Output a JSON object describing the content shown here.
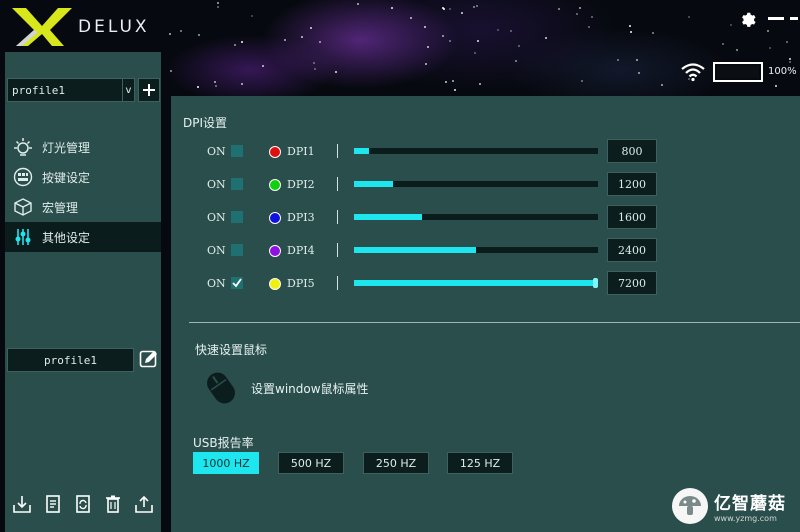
{
  "app": {
    "brand": "DELUX"
  },
  "window": {
    "settings_icon": "gear-icon",
    "minimize_icon": "minimize-icon",
    "close_icon": "close-icon"
  },
  "status": {
    "battery_percent": "100%",
    "battery_level": 1.0,
    "wifi_icon": "wifi-icon"
  },
  "sidebar": {
    "profile_selected": "profile1",
    "profile_dropdown_arrow": "v",
    "add_profile_icon": "plus-icon",
    "menu": [
      {
        "label": "灯光管理",
        "icon": "light-icon",
        "active": false
      },
      {
        "label": "按键设定",
        "icon": "keys-icon",
        "active": false
      },
      {
        "label": "宏管理",
        "icon": "macro-icon",
        "active": false
      },
      {
        "label": "其他设定",
        "icon": "sliders-icon",
        "active": true
      }
    ],
    "profile_name": "profile1",
    "edit_icon": "edit-icon",
    "tools": [
      "import-icon",
      "export-doc-icon",
      "refresh-icon",
      "delete-icon",
      "upload-icon"
    ]
  },
  "dpi": {
    "title": "DPI设置",
    "rows": [
      {
        "on_label": "ON",
        "checked": false,
        "color": "#e01010",
        "label": "DPI1",
        "value": "800",
        "fraction": 0.06
      },
      {
        "on_label": "ON",
        "checked": false,
        "color": "#10d010",
        "label": "DPI2",
        "value": "1200",
        "fraction": 0.16
      },
      {
        "on_label": "ON",
        "checked": false,
        "color": "#1010e0",
        "label": "DPI3",
        "value": "1600",
        "fraction": 0.28
      },
      {
        "on_label": "ON",
        "checked": false,
        "color": "#9010e0",
        "label": "DPI4",
        "value": "2400",
        "fraction": 0.5
      },
      {
        "on_label": "ON",
        "checked": true,
        "color": "#f0f010",
        "label": "DPI5",
        "value": "7200",
        "fraction": 1.0
      }
    ]
  },
  "quick": {
    "title": "快速设置鼠标",
    "mouse_icon": "mouse-icon",
    "mouse_properties": "设置window鼠标属性"
  },
  "usb": {
    "title": "USB报告率",
    "options": [
      "1000 HZ",
      "500 HZ",
      "250 HZ",
      "125 HZ"
    ],
    "selected": "1000 HZ"
  },
  "watermark": {
    "name": "亿智蘑菇",
    "url": "www.yzmg.com"
  },
  "colors": {
    "accent": "#1ee6ee",
    "panel": "#2a4e4c",
    "dark": "#0c1d1e"
  }
}
